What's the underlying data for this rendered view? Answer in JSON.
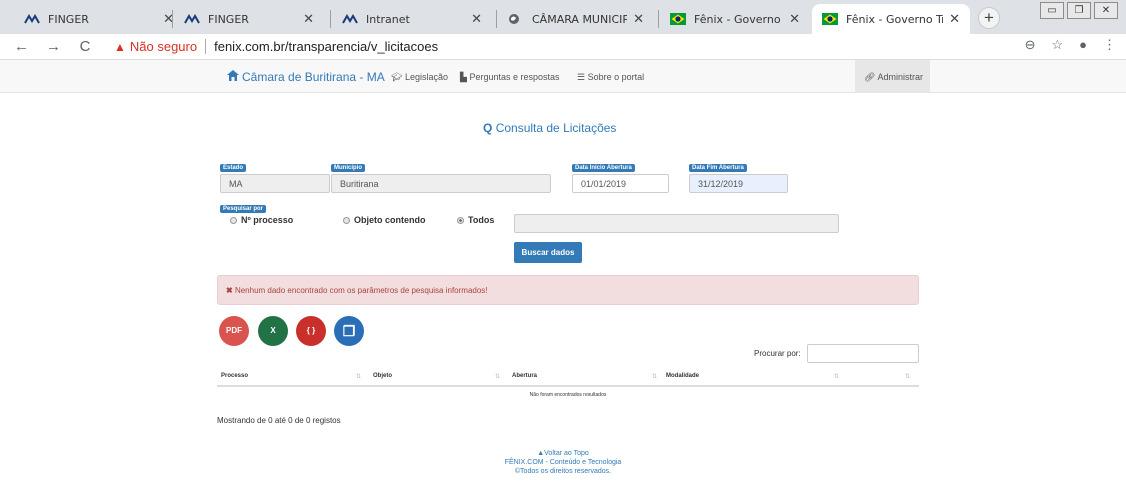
{
  "browser": {
    "tabs": [
      {
        "title": "FINGER"
      },
      {
        "title": "FINGER"
      },
      {
        "title": "Intranet"
      },
      {
        "title": "CÂMARA MUNICIPAL DE"
      },
      {
        "title": "Fênix - Governo Transpa"
      },
      {
        "title": "Fênix - Governo Transpa"
      }
    ],
    "new_tab": "+",
    "back": "←",
    "forward": "→",
    "reload": "C",
    "security_label": "Não seguro",
    "url": "fenix.com.br/transparencia/v_licitacoes"
  },
  "navbar": {
    "brand": "Câmara de Buritirana - MA",
    "links": [
      "Legislação",
      "Perguntas e respostas",
      "Sobre o portal"
    ],
    "admin": "Administrar"
  },
  "page": {
    "title": "Consulta de Licitações",
    "estado_label": "Estado",
    "estado_value": "MA",
    "municipio_label": "Município",
    "municipio_value": "Buritirana",
    "data_inicio_label": "Data Início Abertura",
    "data_inicio_value": "01/01/2019",
    "data_fim_label": "Data Fim Abertura",
    "data_fim_value": "31/12/2019",
    "pesquisar_label": "Pesquisar por",
    "radio_processo": "Nº processo",
    "radio_objeto": "Objeto contendo",
    "radio_todos": "Todos",
    "buscar_button": "Buscar dados",
    "alert": "Nenhum dado encontrado com os parâmetros de pesquisa informados!",
    "search_label": "Procurar por:",
    "columns": [
      "Processo",
      "Objeto",
      "Abertura",
      "Modalidade"
    ],
    "empty_text": "Não foram encontrados resultados",
    "showing": "Mostrando de 0 até 0 de 0 registos"
  },
  "footer": {
    "back_to_top": "Voltar ao Topo",
    "company": "FÊNIX.COM - Conteúdo e Tecnologia",
    "rights": "©Todos os direitos reservados."
  },
  "colors": {
    "primary": "#337ab7",
    "alert_bg": "#f2dede",
    "alert_text": "#a94442",
    "pdf": "#d9534f",
    "excel": "#217346",
    "json": "#c9302c",
    "copy": "#2a6eb8"
  }
}
